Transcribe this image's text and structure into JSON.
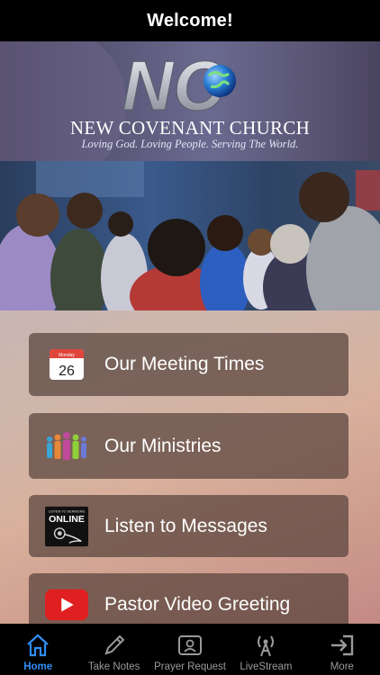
{
  "header": {
    "title": "Welcome!"
  },
  "banner": {
    "logo_letters": "NC",
    "church_name": "NEW COVENANT CHURCH",
    "tagline": "Loving God. Loving People. Serving The World."
  },
  "calendar": {
    "month": "Monday",
    "day": "26"
  },
  "sermons_badge": {
    "small": "LISTEN TO SERMONS",
    "big": "ONLINE"
  },
  "menu": [
    {
      "label": "Our Meeting Times",
      "icon": "calendar-icon"
    },
    {
      "label": "Our Ministries",
      "icon": "people-icon"
    },
    {
      "label": "Listen to Messages",
      "icon": "sermons-online-icon"
    },
    {
      "label": "Pastor Video Greeting",
      "icon": "youtube-play-icon"
    }
  ],
  "tabs": [
    {
      "label": "Home",
      "icon": "home-icon",
      "active": true
    },
    {
      "label": "Take Notes",
      "icon": "pencil-icon"
    },
    {
      "label": "Prayer Request",
      "icon": "prayer-request-icon"
    },
    {
      "label": "LiveStream",
      "icon": "broadcast-icon"
    },
    {
      "label": "More",
      "icon": "more-icon"
    }
  ],
  "colors": {
    "active_tab": "#2f8ef5",
    "menu_button_bg": "#58423c",
    "youtube_red": "#e02020"
  }
}
